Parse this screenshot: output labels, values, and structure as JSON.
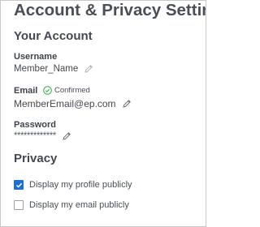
{
  "page": {
    "title": "Account & Privacy Settings"
  },
  "account": {
    "section_title": "Your Account",
    "username": {
      "label": "Username",
      "value": "Member_Name",
      "edit_icon": "pencil-icon"
    },
    "email": {
      "label": "Email",
      "status": "Confirmed",
      "status_icon": "check-circle-icon",
      "status_color": "#3aa54a",
      "value": "MemberEmail@ep.com",
      "edit_icon": "pencil-icon"
    },
    "password": {
      "label": "Password",
      "value": "*************",
      "edit_icon": "pencil-icon"
    }
  },
  "privacy": {
    "section_title": "Privacy",
    "options": [
      {
        "label": "Display my profile publicly",
        "checked": true
      },
      {
        "label": "Display my email publicly",
        "checked": false
      }
    ],
    "checkbox_color": "#1f6fd1"
  }
}
